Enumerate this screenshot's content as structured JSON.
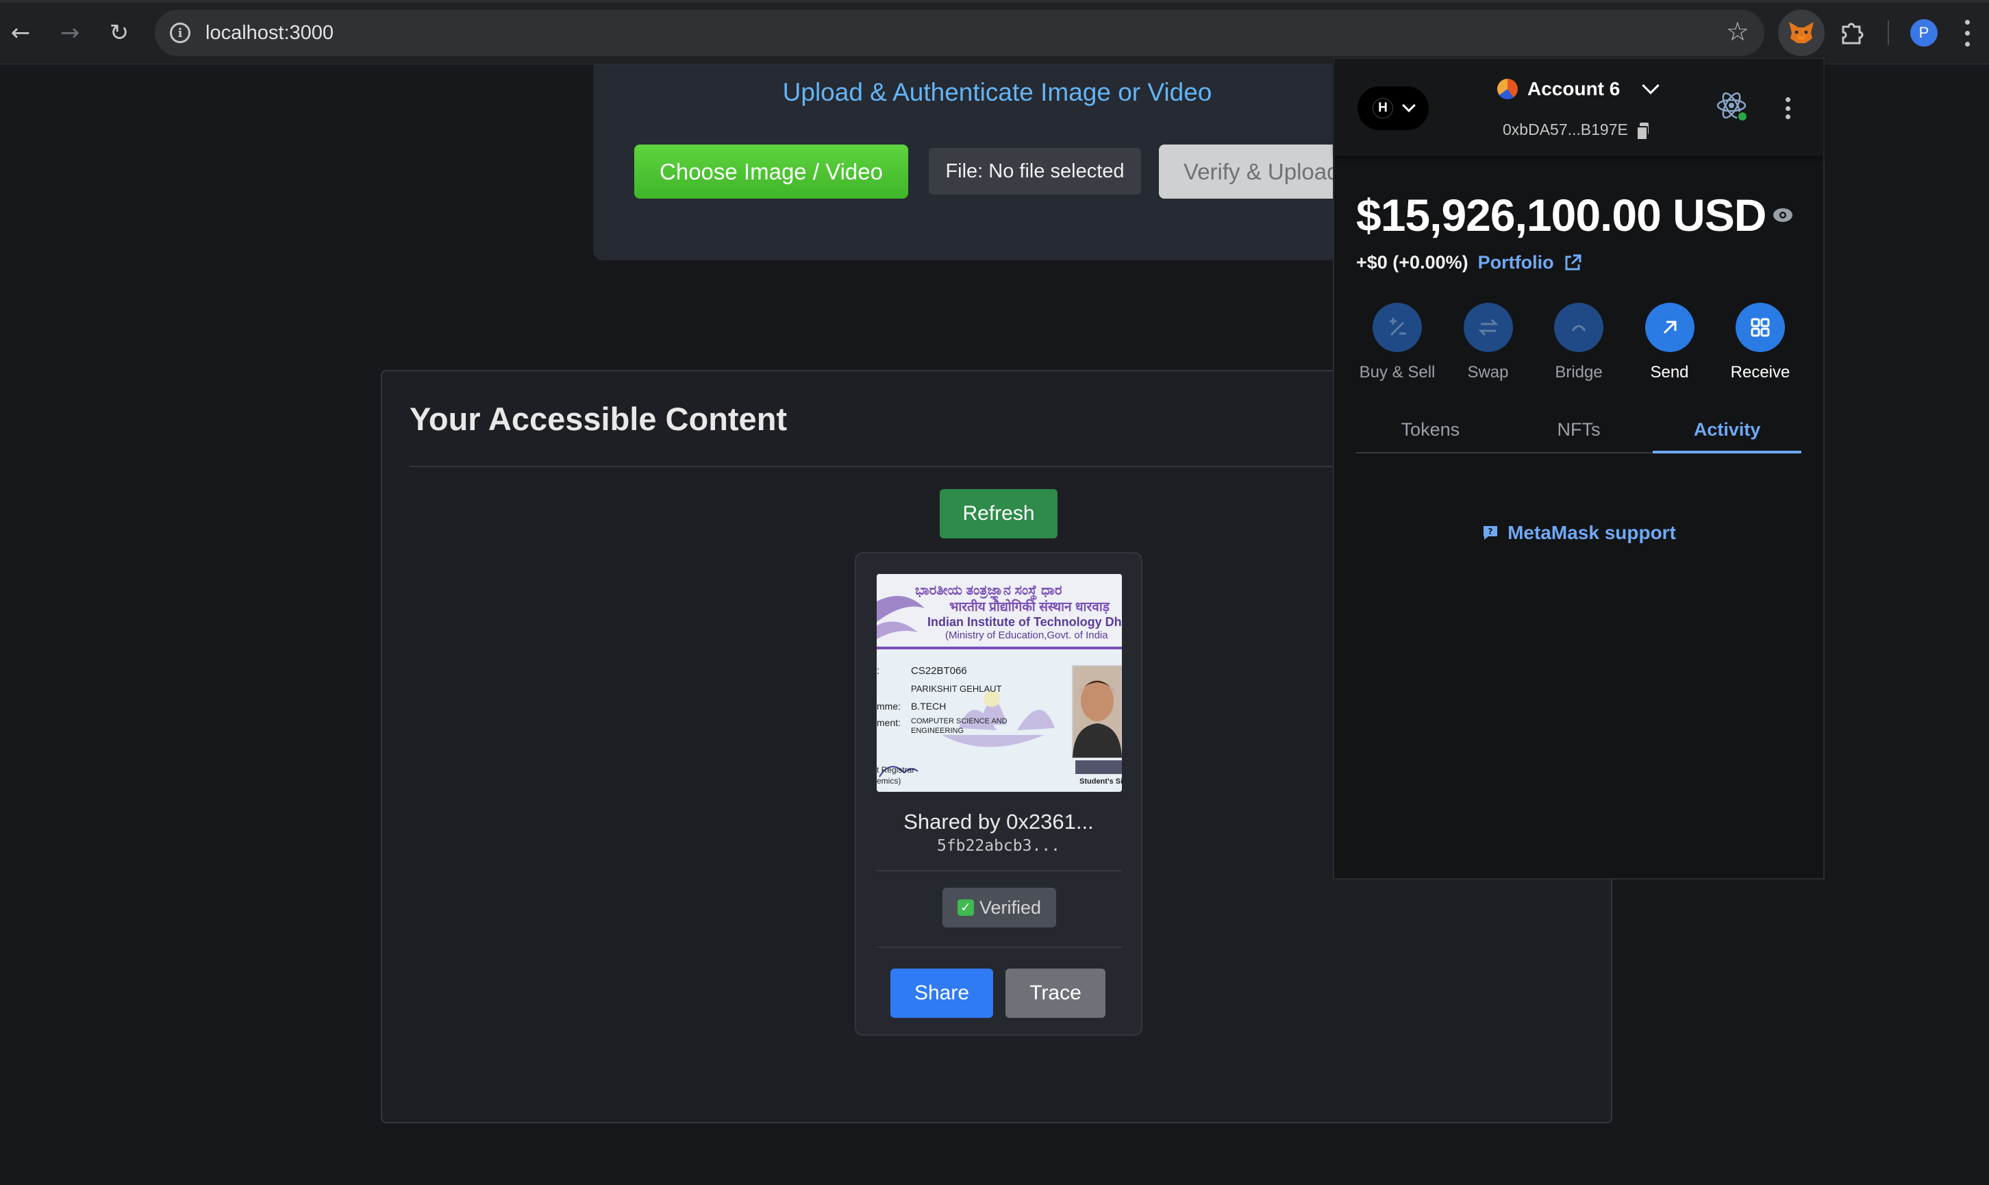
{
  "browser": {
    "url": "localhost:3000",
    "profile_initial": "P",
    "icons": [
      "back-arrow-icon",
      "forward-arrow-icon",
      "reload-icon",
      "site-info-icon",
      "bookmark-star-icon",
      "metamask-fox-icon",
      "extensions-puzzle-icon",
      "chrome-menu-icon"
    ]
  },
  "upload": {
    "title": "Upload & Authenticate Image or Video",
    "choose_label": "Choose Image / Video",
    "file_label": "File: No file selected",
    "verify_label": "Verify & Upload"
  },
  "content": {
    "title": "Your Accessible Content",
    "refresh_label": "Refresh",
    "items": [
      {
        "shared_by": "Shared by 0x2361...",
        "hash": "5fb22abcb3...",
        "status": "Verified",
        "share_label": "Share",
        "trace_label": "Trace",
        "thumbnail": {
          "header_kn": "ಭಾರತೀಯ ತಂತ್ರಜ್ಞಾನ ಸಂಸ್ಥೆ ಧಾರ",
          "header_hi": "भारतीय प्रौद्योगिकी संस्थान धारवाड़",
          "header_en": "Indian Institute of Technology Dhar",
          "sub": "(Ministry of Education,Govt. of India",
          "roll": "CS22BT066",
          "name": "PARIKSHIT GEHLAUT",
          "programme_label": "mme:",
          "programme": "B.TECH",
          "dept_label": "ment:",
          "dept_line1": "COMPUTER SCIENCE AND",
          "dept_line2": "ENGINEERING",
          "registrar": "t Registrar",
          "registrar2": "emics)",
          "student_sign": "Student's Sig"
        }
      }
    ]
  },
  "metamask": {
    "network_initial": "H",
    "account_name": "Account 6",
    "address": "0xbDA57...B197E",
    "balance": "$15,926,100.00 USD",
    "change": "+$0 (+0.00%)",
    "portfolio_label": "Portfolio",
    "actions": [
      {
        "label": "Buy & Sell",
        "icon": "buy-sell-icon",
        "enabled": false
      },
      {
        "label": "Swap",
        "icon": "swap-icon",
        "enabled": false
      },
      {
        "label": "Bridge",
        "icon": "bridge-icon",
        "enabled": false
      },
      {
        "label": "Send",
        "icon": "send-arrow-icon",
        "enabled": true
      },
      {
        "label": "Receive",
        "icon": "receive-qr-icon",
        "enabled": true
      }
    ],
    "tabs": [
      "Tokens",
      "NFTs",
      "Activity"
    ],
    "active_tab": "Activity",
    "support_label": "MetaMask support"
  },
  "colors": {
    "page_bg": "#17181c",
    "accent_green": "#3fb52a",
    "refresh_green": "#2e8b4a",
    "share_blue": "#2f7bf5",
    "link_blue": "#6fa9f5",
    "upload_title": "#64b5f6"
  }
}
